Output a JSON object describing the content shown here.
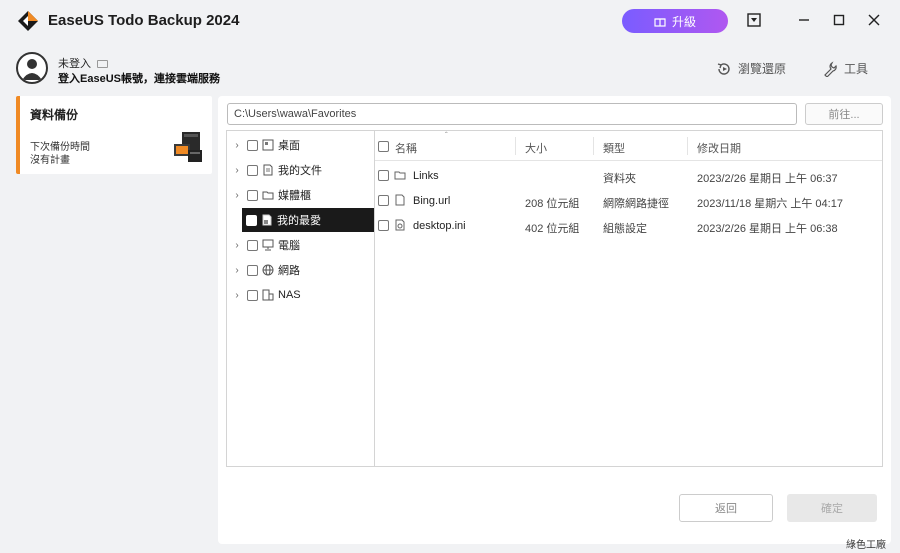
{
  "app": {
    "title": "EaseUS Todo Backup 2024",
    "upgrade_label": "升級"
  },
  "user": {
    "name": "未登入",
    "login_prompt": "登入EaseUS帳號，連接雲端服務"
  },
  "toolbar": {
    "browse_restore": "瀏覽還原",
    "tools": "工具"
  },
  "sidebar": {
    "title": "資料備份",
    "line1": "下次備份時間",
    "line2": "沒有計畫"
  },
  "path": {
    "value": "C:\\Users\\wawa\\Favorites",
    "go_label": "前往..."
  },
  "tree": {
    "items": [
      {
        "label": "桌面",
        "icon": "desktop-icon"
      },
      {
        "label": "我的文件",
        "icon": "document-icon"
      },
      {
        "label": "媒體櫃",
        "icon": "folder-icon"
      },
      {
        "label": "我的最愛",
        "icon": "favorites-icon",
        "selected": true
      },
      {
        "label": "電腦",
        "icon": "computer-icon"
      },
      {
        "label": "網路",
        "icon": "network-icon"
      },
      {
        "label": "NAS",
        "icon": "nas-icon"
      }
    ]
  },
  "list": {
    "headers": {
      "name": "名稱",
      "size": "大小",
      "type": "類型",
      "date": "修改日期"
    },
    "rows": [
      {
        "name": "Links",
        "size": "",
        "type": "資料夾",
        "date": "2023/2/26 星期日 上午 06:37",
        "icon": "folder-icon"
      },
      {
        "name": "Bing.url",
        "size": "208 位元組",
        "type": "網際網路捷徑",
        "date": "2023/11/18 星期六 上午 04:17",
        "icon": "file-icon"
      },
      {
        "name": "desktop.ini",
        "size": "402 位元組",
        "type": "組態設定",
        "date": "2023/2/26 星期日 上午 06:38",
        "icon": "settings-file-icon"
      }
    ]
  },
  "footer": {
    "back_label": "返回",
    "ok_label": "確定"
  },
  "watermark": "綠色工廠",
  "colors": {
    "accent": "#f08a24",
    "upgrade_start": "#7a5cff",
    "upgrade_end": "#b058f0",
    "selected_bg": "#1a1a1a"
  }
}
